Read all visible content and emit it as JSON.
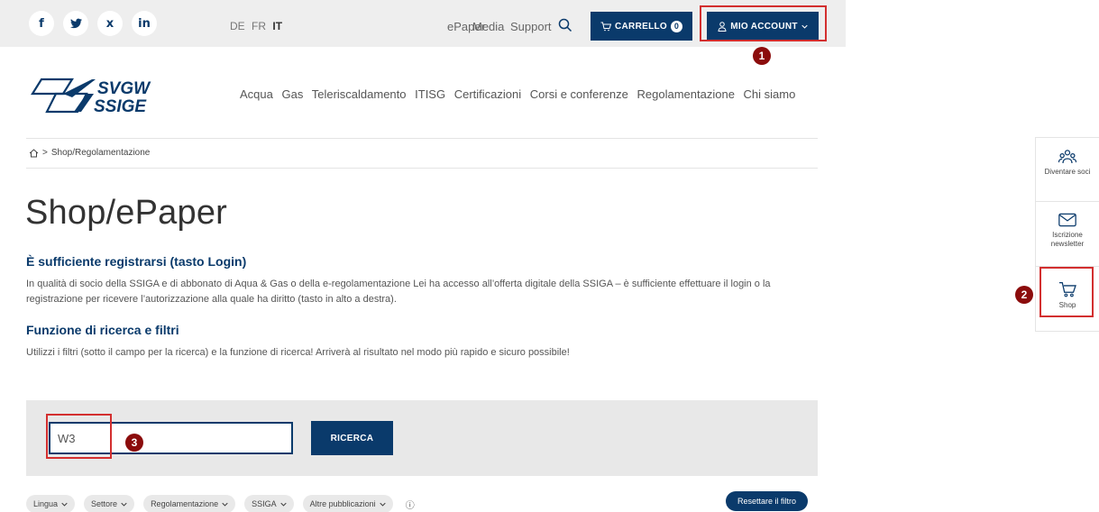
{
  "topbar": {
    "social": [
      {
        "name": "facebook-icon",
        "glyph": "f"
      },
      {
        "name": "twitter-icon",
        "glyph": "🐦"
      },
      {
        "name": "xing-icon",
        "glyph": "x"
      },
      {
        "name": "linkedin-icon",
        "glyph": "in"
      }
    ],
    "languages": [
      "DE",
      "FR",
      "IT"
    ],
    "active_language": "IT",
    "links": [
      "ePaper",
      "Media",
      "Support"
    ],
    "cart_label": "CARRELLO",
    "cart_count": "0",
    "account_label": "MIO ACCOUNT"
  },
  "logo": {
    "line1": "SVGW",
    "line2": "SSIGE"
  },
  "nav": [
    "Acqua",
    "Gas",
    "Teleriscaldamento",
    "ITISG",
    "Certificazioni",
    "Corsi e conferenze",
    "Regolamentazione",
    "Chi siamo"
  ],
  "breadcrumb": {
    "separator": ">",
    "path": "Shop/Regolamentazione"
  },
  "page": {
    "title": "Shop/ePaper",
    "section1_heading": "È sufficiente registrarsi (tasto Login)",
    "section1_text": "In qualità di socio della SSIGA e di abbonato di Aqua & Gas o della e-regolamentazione Lei ha accesso all’offerta digitale della SSIGA – è sufficiente effettuare il login o la registrazione per ricevere l’autorizzazione alla quale ha diritto (tasto in alto a destra).",
    "section2_heading": "Funzione di ricerca e filtri",
    "section2_text": "Utilizzi i filtri (sotto il campo per la ricerca) e la funzione di ricerca! Arriverà al risultato nel modo più rapido e sicuro possibile!"
  },
  "search": {
    "value": "W3",
    "button_label": "RICERCA"
  },
  "filters": [
    "Lingua",
    "Settore",
    "Regolamentazione",
    "SSIGA",
    "Altre pubblicazioni"
  ],
  "filters_info": "ⓘ",
  "reset_label": "Resettare il filtro",
  "rail": [
    {
      "label": "Diventare soci"
    },
    {
      "label": "Iscrizione newsletter"
    },
    {
      "label": "Shop"
    }
  ],
  "annotations": [
    "1",
    "2",
    "3"
  ],
  "colors": {
    "brand": "#0a3a6b",
    "highlight": "#d32f2f",
    "marker": "#8b0c0c"
  }
}
